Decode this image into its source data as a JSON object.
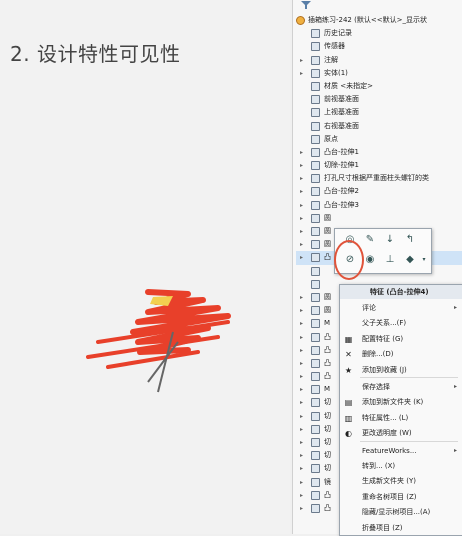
{
  "slide": {
    "title": "2. 设计特性可见性"
  },
  "tree": {
    "root": "插箱练习-242 (默认<<默认>_显示状",
    "items": [
      {
        "label": "历史记录",
        "arrow": ""
      },
      {
        "label": "传感器",
        "arrow": ""
      },
      {
        "label": "注解",
        "arrow": "▸"
      },
      {
        "label": "实体(1)",
        "arrow": "▸"
      },
      {
        "label": "材质 <未指定>",
        "arrow": ""
      },
      {
        "label": "前视基准面",
        "arrow": ""
      },
      {
        "label": "上视基准面",
        "arrow": ""
      },
      {
        "label": "右视基准面",
        "arrow": ""
      },
      {
        "label": "原点",
        "arrow": ""
      },
      {
        "label": "凸台-拉伸1",
        "arrow": "▸"
      },
      {
        "label": "切除-拉伸1",
        "arrow": "▸"
      },
      {
        "label": "打孔尺寸根据严重面柱头螺钉的类",
        "arrow": "▸"
      },
      {
        "label": "凸台-拉伸2",
        "arrow": "▸"
      },
      {
        "label": "凸台-拉伸3",
        "arrow": "▸"
      },
      {
        "label": "圆",
        "arrow": "▸"
      },
      {
        "label": "圆",
        "arrow": "▸"
      },
      {
        "label": "圆",
        "arrow": "▸"
      },
      {
        "label": "凸",
        "arrow": "▸"
      },
      {
        "label": "",
        "arrow": ""
      },
      {
        "label": "",
        "arrow": ""
      },
      {
        "label": "圆",
        "arrow": "▸"
      },
      {
        "label": "圆",
        "arrow": "▸"
      },
      {
        "label": "M",
        "arrow": "▸"
      },
      {
        "label": "凸",
        "arrow": "▸"
      },
      {
        "label": "凸",
        "arrow": "▸"
      },
      {
        "label": "凸",
        "arrow": "▸"
      },
      {
        "label": "凸",
        "arrow": "▸"
      },
      {
        "label": "M",
        "arrow": "▸"
      },
      {
        "label": "切",
        "arrow": "▸"
      },
      {
        "label": "切",
        "arrow": "▸"
      },
      {
        "label": "切",
        "arrow": "▸"
      },
      {
        "label": "切",
        "arrow": "▸"
      },
      {
        "label": "切",
        "arrow": "▸"
      },
      {
        "label": "切",
        "arrow": "▸"
      },
      {
        "label": "镜",
        "arrow": "▸"
      },
      {
        "label": "凸",
        "arrow": "▸"
      },
      {
        "label": "凸",
        "arrow": "▸"
      }
    ]
  },
  "context_menu": {
    "header": "特征 (凸台-拉伸4)",
    "items": [
      {
        "label": "评论",
        "icon": "",
        "sub": "▸"
      },
      {
        "label": "父子关系...(F)",
        "icon": "",
        "sub": ""
      },
      {
        "label": "配置特征 (G)",
        "icon": "▦",
        "sub": ""
      },
      {
        "label": "删除...(D)",
        "icon": "✕",
        "sub": ""
      },
      {
        "label": "添加到收藏 (J)",
        "icon": "★",
        "sub": ""
      },
      {
        "label": "保存选择",
        "icon": "",
        "sub": "▸"
      },
      {
        "label": "添加到新文件夹 (K)",
        "icon": "▤",
        "sub": ""
      },
      {
        "label": "特征属性... (L)",
        "icon": "▥",
        "sub": ""
      },
      {
        "label": "更改透明度 (W)",
        "icon": "◐",
        "sub": ""
      },
      {
        "label": "FeatureWorks...",
        "icon": "",
        "sub": "▸"
      },
      {
        "label": "转到... (X)",
        "icon": "",
        "sub": ""
      },
      {
        "label": "生成新文件夹 (Y)",
        "icon": "",
        "sub": ""
      },
      {
        "label": "重命名树项目 (Z)",
        "icon": "",
        "sub": ""
      },
      {
        "label": "隐藏/显示树项目...(A)",
        "icon": "",
        "sub": ""
      },
      {
        "label": "折叠项目 (Z)",
        "icon": "",
        "sub": ""
      }
    ]
  },
  "colors": {
    "annotation_red": "#e0533a",
    "selection": "#cfe3f7"
  }
}
